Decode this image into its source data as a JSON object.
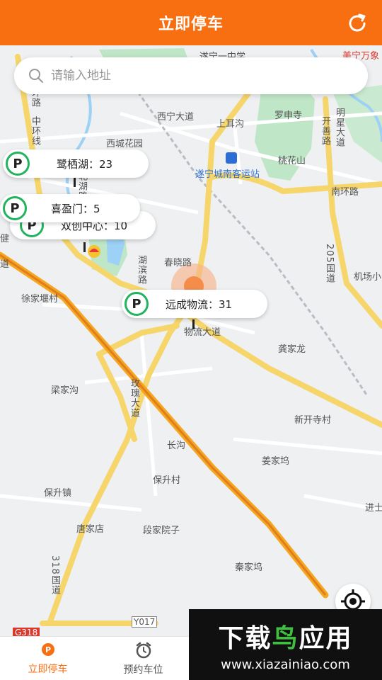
{
  "header": {
    "title": "立即停车",
    "refresh_icon": "refresh-icon"
  },
  "search": {
    "placeholder": "请输入地址",
    "value": ""
  },
  "map": {
    "labels": {
      "l1": "遂宁一中学",
      "l2": "西宁大道",
      "l3": "罗申寺",
      "l4": "明星大道",
      "l5": "开善路",
      "l6": "上耳沟",
      "l7": "西城花园",
      "l8": "桃花山",
      "l9": "遂宁城南客运站",
      "l10": "南环路",
      "l11": "北湖路",
      "l12": "春晓路",
      "l13": "湖滨路",
      "l14": "徐家堰村",
      "l15": "机场小",
      "l16": "205国道",
      "l17": "物流大道",
      "l18": "龚家龙",
      "l19": "梁家沟",
      "l20": "玫瑰大道",
      "l21": "新开寺村",
      "l22": "长沟",
      "l23": "姜家坞",
      "l24": "保升村",
      "l25": "保升镇",
      "l26": "唐家店",
      "l27": "段家院子",
      "l28": "秦家坞",
      "l29": "进士",
      "l30": "318国道",
      "l31": "Y017",
      "l32": "G318",
      "l33": "中环线",
      "l34": "环路",
      "l35": "美宁万象",
      "l36": "双创中心：10",
      "l37": "健",
      "l38": "道"
    }
  },
  "parking": [
    {
      "name": "鹭栖湖：23"
    },
    {
      "name": "喜盈门：5"
    },
    {
      "name": "远成物流：31"
    }
  ],
  "tabs": [
    {
      "label": "立即停车",
      "active": true
    },
    {
      "label": "预约车位",
      "active": false
    }
  ],
  "watermark": {
    "title_a": "下载",
    "title_b": "鸟",
    "title_c": "应用",
    "url": "www.xiazainiao.com"
  },
  "colors": {
    "accent": "#f86f12",
    "park_green": "#22b35e",
    "highway": "#f5a623"
  }
}
